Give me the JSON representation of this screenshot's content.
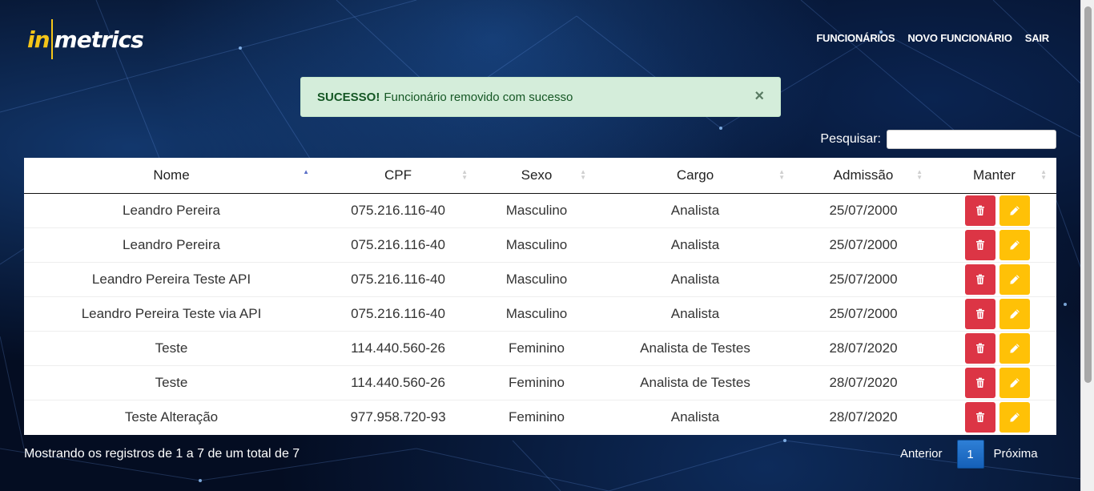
{
  "brand": {
    "logo_in": "in",
    "logo_rest": "metrics"
  },
  "nav": {
    "items": [
      "FUNCIONÁRIOS",
      "NOVO FUNCIONÁRIO",
      "SAIR"
    ]
  },
  "alert": {
    "title": "SUCESSO!",
    "message": "Funcionário removido com sucesso",
    "close": "×"
  },
  "search": {
    "label": "Pesquisar:",
    "value": ""
  },
  "table": {
    "columns": [
      "Nome",
      "CPF",
      "Sexo",
      "Cargo",
      "Admissão",
      "Manter"
    ],
    "rows": [
      [
        "Leandro Pereira",
        "075.216.116-40",
        "Masculino",
        "Analista",
        "25/07/2000"
      ],
      [
        "Leandro Pereira",
        "075.216.116-40",
        "Masculino",
        "Analista",
        "25/07/2000"
      ],
      [
        "Leandro Pereira Teste API",
        "075.216.116-40",
        "Masculino",
        "Analista",
        "25/07/2000"
      ],
      [
        "Leandro Pereira Teste via API",
        "075.216.116-40",
        "Masculino",
        "Analista",
        "25/07/2000"
      ],
      [
        "Teste",
        "114.440.560-26",
        "Feminino",
        "Analista de Testes",
        "28/07/2020"
      ],
      [
        "Teste",
        "114.440.560-26",
        "Feminino",
        "Analista de Testes",
        "28/07/2020"
      ],
      [
        "Teste Alteração",
        "977.958.720-93",
        "Feminino",
        "Analista",
        "28/07/2020"
      ]
    ],
    "sorted_column": "Nome",
    "sort_direction": "ascending"
  },
  "footer": {
    "info": "Mostrando os registros de 1 a 7 de um total de 7",
    "prev": "Anterior",
    "current_page": "1",
    "next": "Próxima"
  },
  "colors": {
    "delete_button": "#dc3545",
    "edit_button": "#ffc107",
    "alert_bg": "#d4edda",
    "alert_text": "#155724",
    "logo_accent": "#f5c518",
    "page_active": "#1560b8"
  },
  "icons": {
    "delete": "trash-icon",
    "edit": "pencil-icon",
    "sort": "sort-arrows-icon"
  }
}
